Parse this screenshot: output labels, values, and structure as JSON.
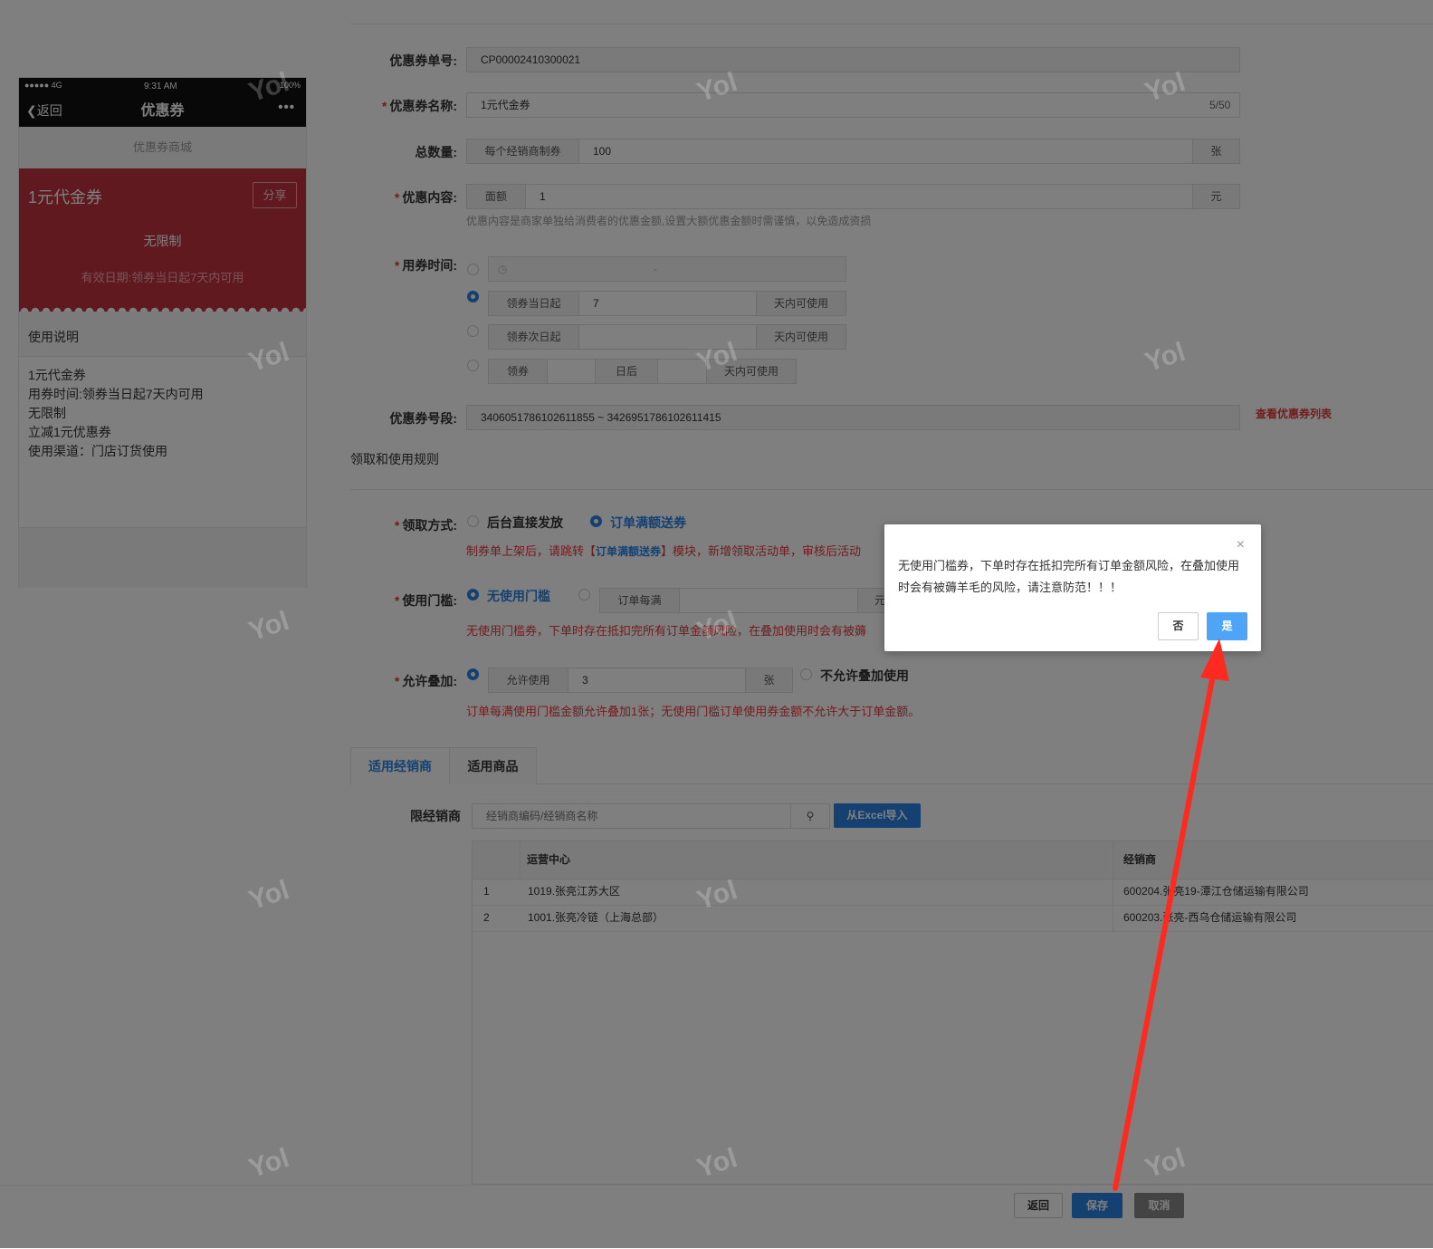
{
  "phone": {
    "status_signal": "●●●●● 4G",
    "status_time": "9:31 AM",
    "status_battery": "100%",
    "back_label": "返回",
    "title": "优惠券",
    "more": "•••",
    "mall_label": "优惠券商城",
    "coupon_name": "1元代金券",
    "share_label": "分享",
    "coupon_limit": "无限制",
    "coupon_valid": "有效日期:领券当日起7天内可用",
    "usage_title": "使用说明",
    "usage_lines": [
      "1元代金券",
      "用券时间:领券当日起7天内可用",
      "无限制",
      "立减1元优惠券",
      "使用渠道：门店订货使用"
    ]
  },
  "form": {
    "code_label": "优惠券单号:",
    "code_value": "CP00002410300021",
    "name_label": "优惠券名称:",
    "name_value": "1元代金券",
    "name_count": "5/50",
    "total_label": "总数量:",
    "total_prefix": "每个经销商制券",
    "total_value": "100",
    "total_unit": "张",
    "content_label": "优惠内容:",
    "content_prefix": "面额",
    "content_value": "1",
    "content_unit": "元",
    "content_hint": "优惠内容是商家单独给消费者的优惠金额,设置大额优惠金额时需谨慎，以免造成资损",
    "time_label": "用券时间:",
    "time_range_dash": "-",
    "time_opt2_prefix": "领券当日起",
    "time_opt2_value": "7",
    "time_opt2_suffix": "天内可使用",
    "time_opt3_prefix": "领券次日起",
    "time_opt3_suffix": "天内可使用",
    "time_opt4_prefix": "领券",
    "time_opt4_mid": "日后",
    "time_opt4_suffix": "天内可使用",
    "segment_label": "优惠券号段:",
    "segment_value": "3406051786102611855 ~ 3426951786102611415",
    "segment_link": "查看优惠券列表",
    "section_title": "领取和使用规则",
    "receive_label": "领取方式:",
    "receive_opt1": "后台直接发放",
    "receive_opt2": "订单满额送券",
    "receive_note_a": "制券单上架后，请跳转【",
    "receive_note_link": "订单满额送券",
    "receive_note_b": "】模块，新增领取活动单，审核后活动",
    "threshold_label": "使用门槛:",
    "threshold_opt1": "无使用门槛",
    "threshold_prefix": "订单每满",
    "threshold_unit": "元",
    "threshold_warn": "无使用门槛券，下单时存在抵扣完所有订单金额风险，在叠加使用时会有被薅",
    "stack_label": "允许叠加:",
    "stack_prefix": "允许使用",
    "stack_value": "3",
    "stack_unit": "张",
    "stack_opt2": "不允许叠加使用",
    "stack_note": "订单每满使用门槛金额允许叠加1张；无使用门槛订单使用券金额不允许大于订单金额。",
    "tab1": "适用经销商",
    "tab2": "适用商品",
    "dealer_label": "限经销商",
    "dealer_placeholder": "经销商编码/经销商名称",
    "import_btn": "从Excel导入",
    "table": {
      "headers": [
        "运营中心",
        "经销商"
      ],
      "rows": [
        {
          "idx": "1",
          "center": "1019.张亮江苏大区",
          "dealer": "600204.张亮19-潭江仓储运输有限公司"
        },
        {
          "idx": "2",
          "center": "1001.张亮冷链（上海总部）",
          "dealer": "600203.张亮-西乌仓储运输有限公司"
        }
      ]
    },
    "btn_back": "返回",
    "btn_save": "保存",
    "btn_cancel": "取消"
  },
  "modal": {
    "message": "无使用门槛券，下单时存在抵扣完所有订单金额风险，在叠加使用时会有被薅羊毛的风险，请注意防范！！！",
    "close": "×",
    "no": "否",
    "yes": "是"
  },
  "watermark": "Yol",
  "colors": {
    "primary": "#2a82e4",
    "danger": "#e4393c",
    "coupon": "#c0323f",
    "arrow": "#ff2a1f"
  }
}
